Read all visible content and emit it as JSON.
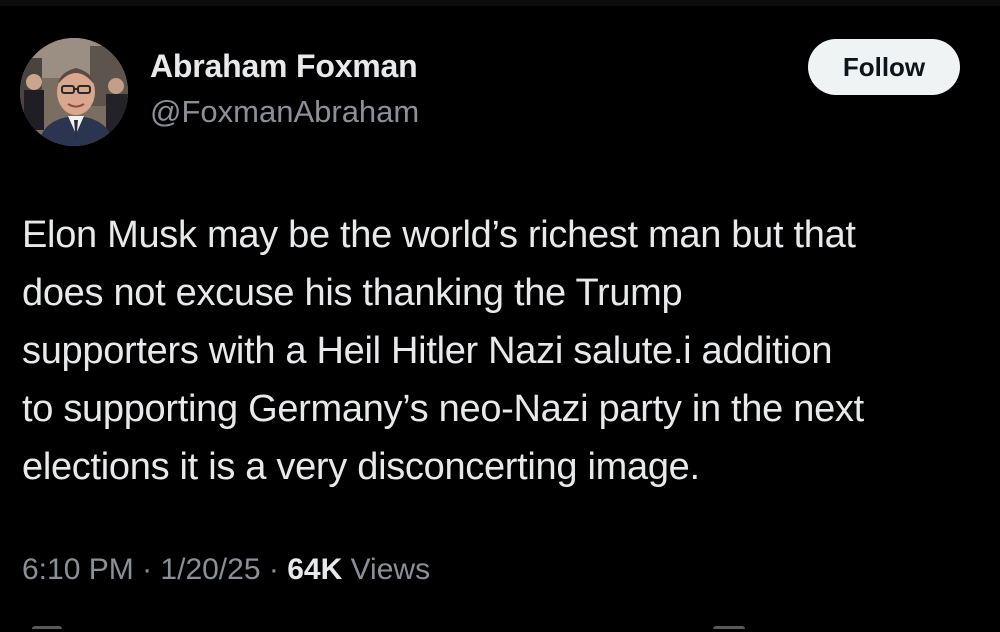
{
  "author": {
    "display_name": "Abraham Foxman",
    "handle": "@FoxmanAbraham",
    "avatar": "profile-photo-avatar"
  },
  "actions": {
    "follow_label": "Follow"
  },
  "tweet": {
    "text": "Elon Musk may be the world’s richest man but that\ndoes not excuse his thanking the Trump\nsupporters with a Heil Hitler Nazi salute.i addition\nto supporting Germany’s neo-Nazi party in the next\nelections it is a very disconcerting image."
  },
  "meta": {
    "time": "6:10 PM",
    "separator": "·",
    "date": "1/20/25",
    "views_count": "64K",
    "views_label": "Views"
  },
  "colors": {
    "background": "#000000",
    "primary_text": "#e7e9ea",
    "secondary_text": "#8b9096",
    "follow_button_bg": "#eff3f4",
    "follow_button_text": "#0f1419"
  }
}
